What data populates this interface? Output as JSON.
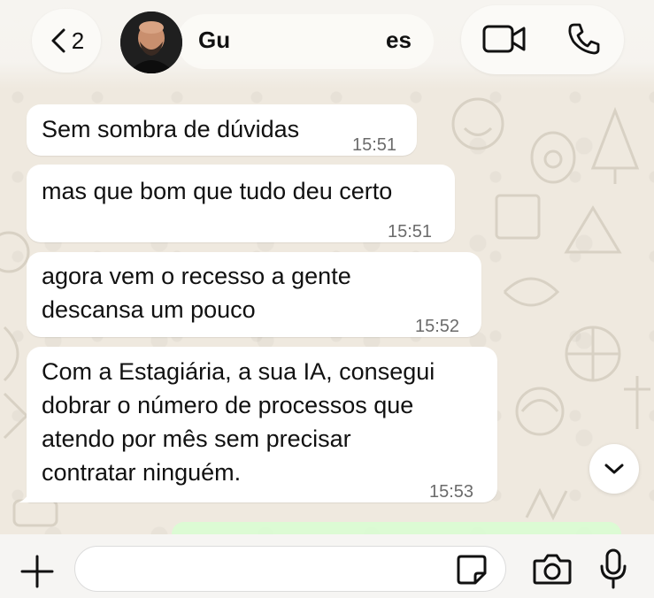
{
  "header": {
    "back_count": "2",
    "contact_name_left": "Gu",
    "contact_name_right": "es"
  },
  "messages": [
    {
      "text": "Sem sombra de dúvidas",
      "time": "15:51"
    },
    {
      "text": "mas que bom que tudo deu certo",
      "time": "15:51"
    },
    {
      "lines": [
        "agora vem o recesso a gente",
        "descansa um pouco"
      ],
      "time": "15:52"
    },
    {
      "lines": [
        "Com a Estagiária, a sua IA, consegui",
        "dobrar o número de processos que",
        "atendo por mês sem precisar",
        "contratar ninguém."
      ],
      "time": "15:53"
    }
  ],
  "composer": {
    "input_value": ""
  },
  "colors": {
    "chat_background": "#efe9df",
    "incoming_bubble": "#ffffff",
    "outgoing_bubble": "#d9fdd3",
    "timestamp": "#6b6b6b"
  },
  "icons": [
    "chevron-left-icon",
    "video-call-icon",
    "phone-icon",
    "chevron-down-icon",
    "plus-icon",
    "sticker-icon",
    "camera-icon",
    "microphone-icon"
  ]
}
